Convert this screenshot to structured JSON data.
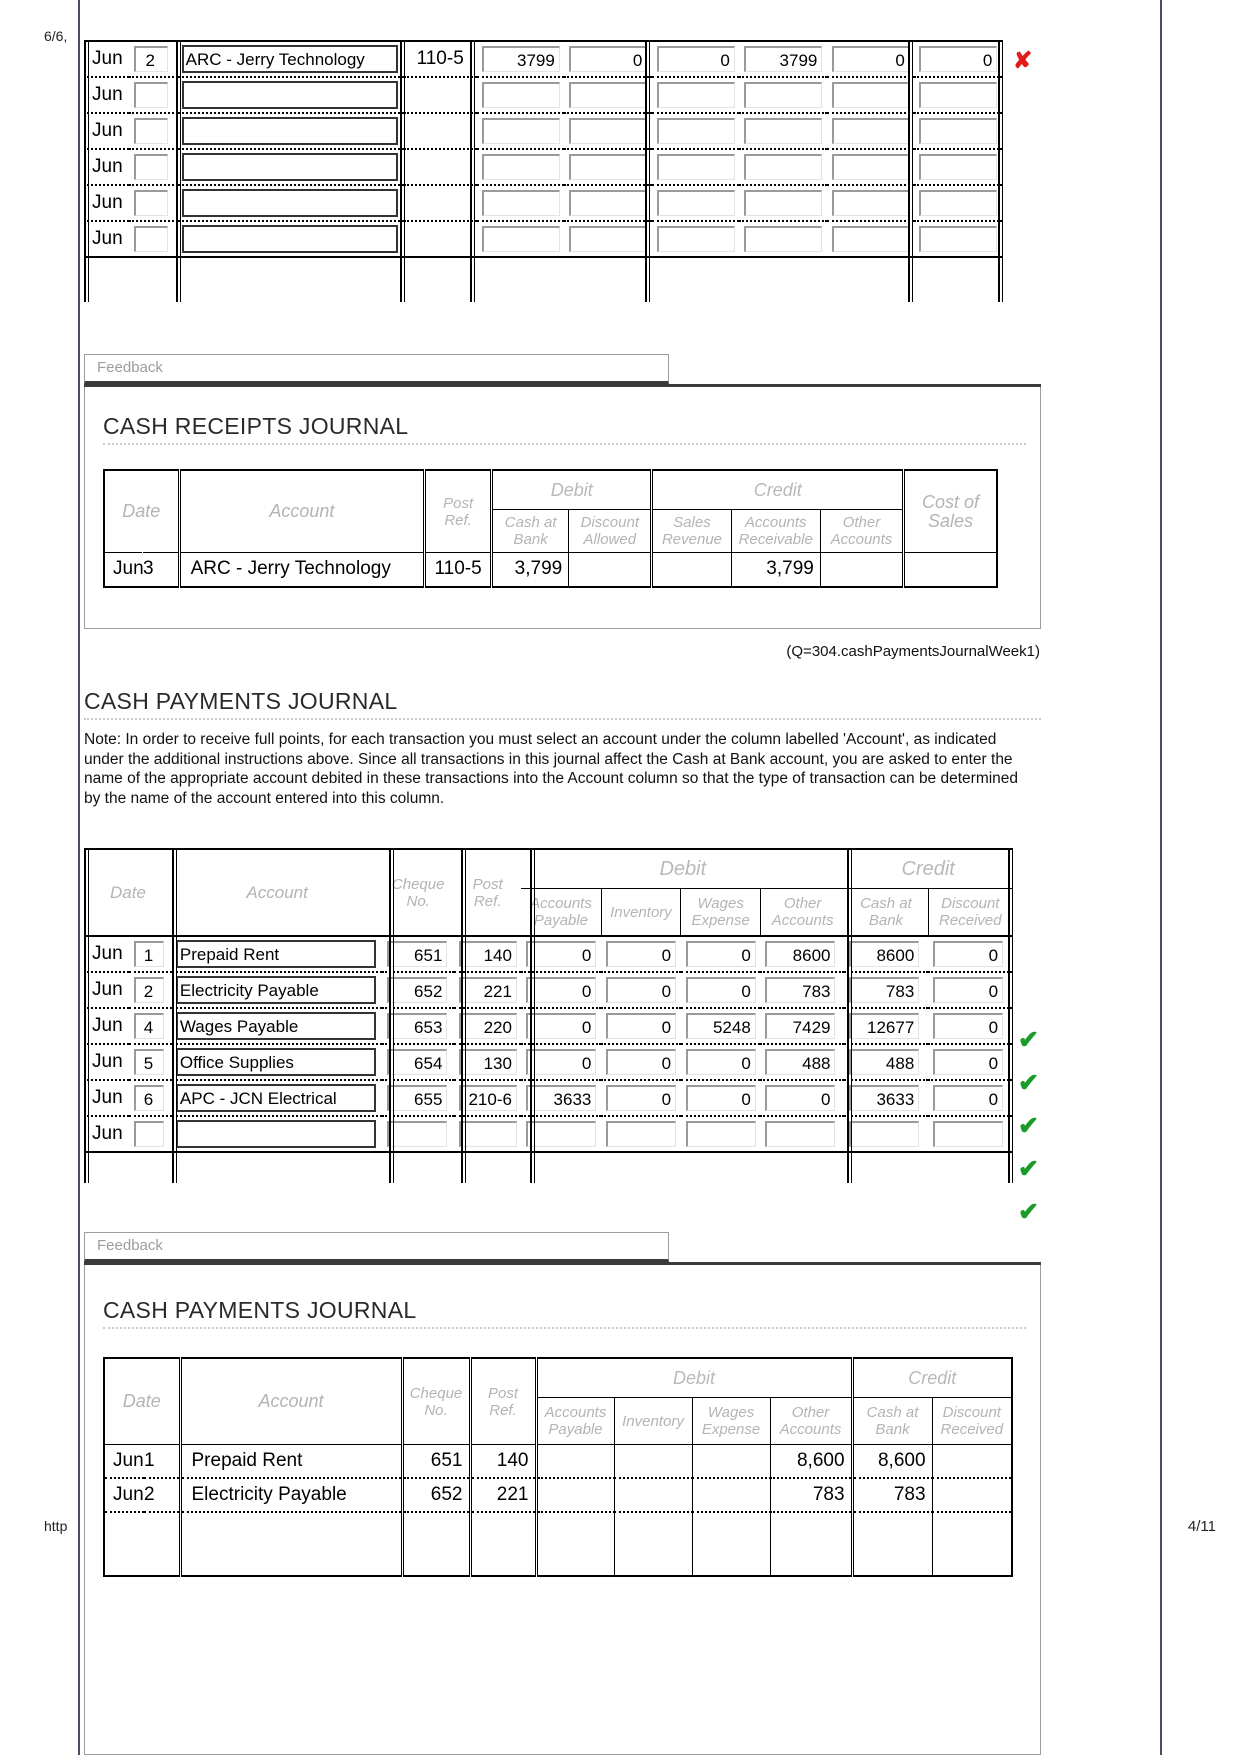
{
  "browser_chrome": {
    "header_left": "6/6,",
    "footer_left": "http",
    "footer_right": "4/11"
  },
  "cash_receipts_entry": {
    "rows": [
      {
        "month": "Jun",
        "day": "2",
        "account": "ARC - Jerry Technology",
        "post_ref": "110-5",
        "cash_at_bank": "3799",
        "discount_allowed": "0",
        "sales_revenue": "0",
        "accounts_receivable": "3799",
        "other_accounts": "0",
        "cost_of_sales": "0",
        "mark": "cross"
      },
      {
        "month": "Jun",
        "day": "",
        "account": "",
        "post_ref": "",
        "cash_at_bank": "",
        "discount_allowed": "",
        "sales_revenue": "",
        "accounts_receivable": "",
        "other_accounts": "",
        "cost_of_sales": "",
        "mark": ""
      },
      {
        "month": "Jun",
        "day": "",
        "account": "",
        "post_ref": "",
        "cash_at_bank": "",
        "discount_allowed": "",
        "sales_revenue": "",
        "accounts_receivable": "",
        "other_accounts": "",
        "cost_of_sales": "",
        "mark": ""
      },
      {
        "month": "Jun",
        "day": "",
        "account": "",
        "post_ref": "",
        "cash_at_bank": "",
        "discount_allowed": "",
        "sales_revenue": "",
        "accounts_receivable": "",
        "other_accounts": "",
        "cost_of_sales": "",
        "mark": ""
      },
      {
        "month": "Jun",
        "day": "",
        "account": "",
        "post_ref": "",
        "cash_at_bank": "",
        "discount_allowed": "",
        "sales_revenue": "",
        "accounts_receivable": "",
        "other_accounts": "",
        "cost_of_sales": "",
        "mark": ""
      },
      {
        "month": "Jun",
        "day": "",
        "account": "",
        "post_ref": "",
        "cash_at_bank": "",
        "discount_allowed": "",
        "sales_revenue": "",
        "accounts_receivable": "",
        "other_accounts": "",
        "cost_of_sales": "",
        "mark": ""
      }
    ]
  },
  "crj_feedback": {
    "feedback_label": "Feedback",
    "title": "CASH RECEIPTS JOURNAL",
    "headers": {
      "date": "Date",
      "account": "Account",
      "post_ref_l1": "Post",
      "post_ref_l2": "Ref.",
      "debit": "Debit",
      "credit": "Credit",
      "cash_at_bank_l1": "Cash at",
      "cash_at_bank_l2": "Bank",
      "discount_allowed_l1": "Discount",
      "discount_allowed_l2": "Allowed",
      "sales_revenue_l1": "Sales",
      "sales_revenue_l2": "Revenue",
      "accounts_receivable_l1": "Accounts",
      "accounts_receivable_l2": "Receivable",
      "other_accounts_l1": "Other",
      "other_accounts_l2": "Accounts",
      "cost_of_sales_l1": "Cost of",
      "cost_of_sales_l2": "Sales"
    },
    "rows": [
      {
        "month": "Jun",
        "day": "3",
        "account": "ARC - Jerry Technology",
        "post_ref": "110-5",
        "cash_at_bank": "3,799",
        "discount_allowed": "",
        "sales_revenue": "",
        "accounts_receivable": "3,799",
        "other_accounts": "",
        "cost_of_sales": ""
      }
    ]
  },
  "cpj": {
    "question_tag": "(Q=304.cashPaymentsJournalWeek1)",
    "title": "CASH PAYMENTS JOURNAL",
    "note": "Note: In order to receive full points, for each transaction you must select an account under the column labelled 'Account', as indicated under the additional instructions above. Since all transactions in this journal affect the Cash at Bank account, you are asked to enter the name of the appropriate account debited in these transactions into the Account column so that the type of transaction can be determined by the name of the account entered into this column.",
    "headers": {
      "date": "Date",
      "account": "Account",
      "cheque_no_l1": "Cheque",
      "cheque_no_l2": "No.",
      "post_ref_l1": "Post",
      "post_ref_l2": "Ref.",
      "debit": "Debit",
      "credit": "Credit",
      "accounts_payable_l1": "Accounts",
      "accounts_payable_l2": "Payable",
      "inventory": "Inventory",
      "wages_expense_l1": "Wages",
      "wages_expense_l2": "Expense",
      "other_accounts_l1": "Other",
      "other_accounts_l2": "Accounts",
      "cash_at_bank_l1": "Cash at",
      "cash_at_bank_l2": "Bank",
      "discount_received_l1": "Discount",
      "discount_received_l2": "Received"
    },
    "rows": [
      {
        "month": "Jun",
        "day": "1",
        "account": "Prepaid Rent",
        "cheque_no": "651",
        "post_ref": "140",
        "accounts_payable": "0",
        "inventory": "0",
        "wages_expense": "0",
        "other_accounts": "8600",
        "cash_at_bank": "8600",
        "discount_received": "0",
        "mark": "tick"
      },
      {
        "month": "Jun",
        "day": "2",
        "account": "Electricity Payable",
        "cheque_no": "652",
        "post_ref": "221",
        "accounts_payable": "0",
        "inventory": "0",
        "wages_expense": "0",
        "other_accounts": "783",
        "cash_at_bank": "783",
        "discount_received": "0",
        "mark": "tick"
      },
      {
        "month": "Jun",
        "day": "4",
        "account": "Wages Payable",
        "cheque_no": "653",
        "post_ref": "220",
        "accounts_payable": "0",
        "inventory": "0",
        "wages_expense": "5248",
        "other_accounts": "7429",
        "cash_at_bank": "12677",
        "discount_received": "0",
        "mark": "tick"
      },
      {
        "month": "Jun",
        "day": "5",
        "account": "Office Supplies",
        "cheque_no": "654",
        "post_ref": "130",
        "accounts_payable": "0",
        "inventory": "0",
        "wages_expense": "0",
        "other_accounts": "488",
        "cash_at_bank": "488",
        "discount_received": "0",
        "mark": "tick"
      },
      {
        "month": "Jun",
        "day": "6",
        "account": "APC - JCN Electrical",
        "cheque_no": "655",
        "post_ref": "210-6",
        "accounts_payable": "3633",
        "inventory": "0",
        "wages_expense": "0",
        "other_accounts": "0",
        "cash_at_bank": "3633",
        "discount_received": "0",
        "mark": "tick"
      },
      {
        "month": "Jun",
        "day": "",
        "account": "",
        "cheque_no": "",
        "post_ref": "",
        "accounts_payable": "",
        "inventory": "",
        "wages_expense": "",
        "other_accounts": "",
        "cash_at_bank": "",
        "discount_received": "",
        "mark": ""
      }
    ]
  },
  "cpj_feedback": {
    "feedback_label": "Feedback",
    "title": "CASH PAYMENTS JOURNAL",
    "rows": [
      {
        "month": "Jun",
        "day": "1",
        "account": "Prepaid Rent",
        "cheque_no": "651",
        "post_ref": "140",
        "accounts_payable": "",
        "inventory": "",
        "wages_expense": "",
        "other_accounts": "8,600",
        "cash_at_bank": "8,600",
        "discount_received": ""
      },
      {
        "month": "Jun",
        "day": "2",
        "account": "Electricity Payable",
        "cheque_no": "652",
        "post_ref": "221",
        "accounts_payable": "",
        "inventory": "",
        "wages_expense": "",
        "other_accounts": "783",
        "cash_at_bank": "783",
        "discount_received": ""
      }
    ]
  },
  "colors": {
    "tick": "#1a9c28",
    "cross": "#e11b1b",
    "header_text": "#b4b4b4",
    "page_border": "#4a4a6a"
  }
}
